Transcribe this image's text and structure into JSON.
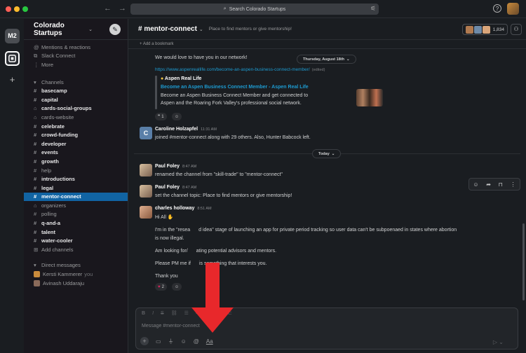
{
  "window": {
    "search_placeholder": "Search Colorado Startups",
    "help_icon": "?"
  },
  "rail": {
    "workspace_abbr": "M2",
    "add_symbol": "+"
  },
  "sidebar": {
    "workspace_name": "Colorado Startups",
    "top_items": [
      {
        "label": "Mentions & reactions",
        "icon": "at-icon"
      },
      {
        "label": "Slack Connect",
        "icon": "connect-icon"
      },
      {
        "label": "More",
        "icon": "more-icon"
      }
    ],
    "channels_header": "Channels",
    "channels": [
      {
        "label": "basecamp",
        "prefix": "#",
        "bold": true
      },
      {
        "label": "capital",
        "prefix": "#",
        "bold": true
      },
      {
        "label": "cards-social-groups",
        "prefix": "lock",
        "bold": true
      },
      {
        "label": "cards-website",
        "prefix": "lock",
        "bold": false
      },
      {
        "label": "celebrate",
        "prefix": "#",
        "bold": true
      },
      {
        "label": "crowd-funding",
        "prefix": "#",
        "bold": true
      },
      {
        "label": "developer",
        "prefix": "#",
        "bold": true
      },
      {
        "label": "events",
        "prefix": "#",
        "bold": true
      },
      {
        "label": "growth",
        "prefix": "#",
        "bold": true
      },
      {
        "label": "help",
        "prefix": "#",
        "bold": false
      },
      {
        "label": "introductions",
        "prefix": "#",
        "bold": true
      },
      {
        "label": "legal",
        "prefix": "#",
        "bold": true
      },
      {
        "label": "mentor-connect",
        "prefix": "#",
        "bold": true,
        "active": true
      },
      {
        "label": "organizers",
        "prefix": "lock",
        "bold": false
      },
      {
        "label": "polling",
        "prefix": "#",
        "bold": false
      },
      {
        "label": "q-and-a",
        "prefix": "#",
        "bold": true
      },
      {
        "label": "talent",
        "prefix": "#",
        "bold": true
      },
      {
        "label": "water-cooler",
        "prefix": "#",
        "bold": true
      }
    ],
    "add_channels": "Add channels",
    "dm_header": "Direct messages",
    "dms": [
      {
        "name": "Kersti Kammerer",
        "suffix": "you"
      },
      {
        "name": "Avinash Uddaraju",
        "suffix": ""
      }
    ]
  },
  "channel": {
    "name": "# mentor-connect",
    "topic": "Place to find mentors or give mentorship!",
    "member_count": "1,834",
    "bookmark": "+ Add a bookmark"
  },
  "messages": {
    "m0_text": "We would love to have you in our network!",
    "day1": "Thursday, August 18th",
    "m0_link": "https://www.aspenreallife.com/become-an-aspen-business-connect-member/",
    "m0_edited": "(edited)",
    "unfurl_site": "Aspen Real Life",
    "unfurl_title": "Become an Aspen Business Connect Member - Aspen Real Life",
    "unfurl_desc1": "Become an Aspen Business Connect Member and get connected to",
    "unfurl_desc2": "Aspen and the Roaring Fork Valley's professional social network.",
    "m0_reaction_count": "1",
    "m1_author": "Caroline Holzapfel",
    "m1_time": "11:31 AM",
    "m1_avatar_letter": "C",
    "m1_text": "joined #mentor-connect along with 29 others. Also, Hunter Babcock left.",
    "day2": "Today",
    "m2_author": "Paul Foley",
    "m2_time": "8:47 AM",
    "m2_text": "renamed the channel from \"skill-trade\" to \"mentor-connect\"",
    "m3_author": "Paul Foley",
    "m3_time": "8:47 AM",
    "m3_text": "set the channel topic: Place to find mentors or give mentorship!",
    "m4_author": "charles holloway",
    "m4_time": "8:51 AM",
    "m4_greeting": "Hi All",
    "m4_p1a": "I'm in the \"resea",
    "m4_p1b": "d idea\" stage of launching an app for private period tracking so user data can't be subpoenaed in states where abortion",
    "m4_p1c": "is now illegal.",
    "m4_p2a": "Am looking for/",
    "m4_p2b": "ating potential advisors and mentors.",
    "m4_p3a": "Please PM me if",
    "m4_p3b": "is something that interests you.",
    "m4_p4": "Thank you",
    "m4_reaction_count": "2"
  },
  "composer": {
    "placeholder": "Message #mentor-connect",
    "format_icons": [
      "B",
      "I",
      "S",
      "link",
      "ol",
      "ul",
      "quote",
      "code",
      "codeblock"
    ],
    "aa_label": "Aa"
  },
  "annotation": {
    "arrow_color": "#e8282b"
  }
}
